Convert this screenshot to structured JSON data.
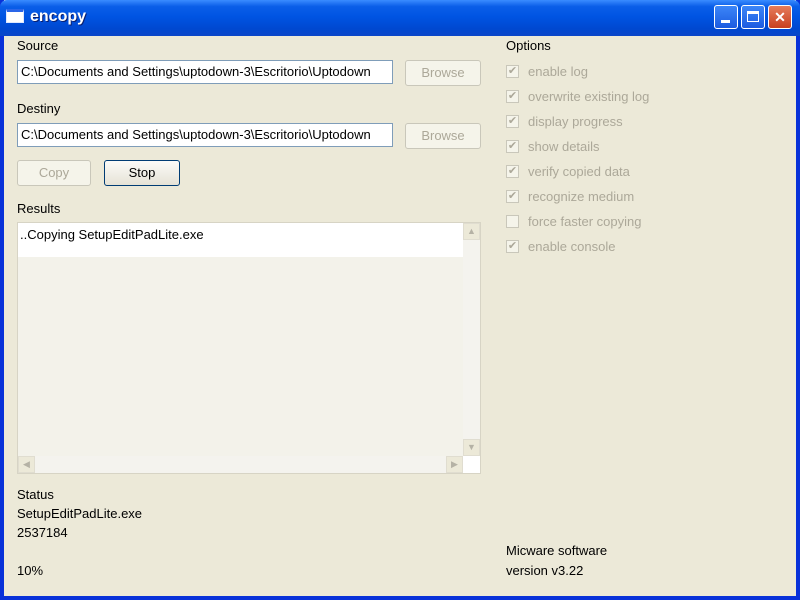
{
  "window": {
    "title": "encopy"
  },
  "titlebar": {
    "minimize": "minimize",
    "maximize": "maximize",
    "close": "✕"
  },
  "source": {
    "label": "Source",
    "value": "C:\\Documents and Settings\\uptodown-3\\Escritorio\\Uptodown",
    "browse": "Browse"
  },
  "destiny": {
    "label": "Destiny",
    "value": "C:\\Documents and Settings\\uptodown-3\\Escritorio\\Uptodown",
    "browse": "Browse"
  },
  "buttons": {
    "copy": "Copy",
    "stop": "Stop"
  },
  "results": {
    "label": "Results",
    "lines": [
      "..Copying SetupEditPadLite.exe"
    ]
  },
  "status": {
    "label": "Status",
    "file": "SetupEditPadLite.exe",
    "bytes": "2537184",
    "percent": "10%"
  },
  "options": {
    "label": "Options",
    "items": [
      {
        "label": "enable log",
        "checked": true
      },
      {
        "label": "overwrite existing log",
        "checked": true
      },
      {
        "label": "display progress",
        "checked": true
      },
      {
        "label": "show details",
        "checked": true
      },
      {
        "label": "verify copied data",
        "checked": true
      },
      {
        "label": "recognize medium",
        "checked": true
      },
      {
        "label": "force faster copying",
        "checked": false
      },
      {
        "label": "enable console",
        "checked": true
      }
    ]
  },
  "footer": {
    "company": "Micware software",
    "version": "version v3.22"
  },
  "icons": {
    "scroll_up": "arrow-up-icon",
    "scroll_down": "arrow-down-icon",
    "scroll_left": "arrow-left-icon",
    "scroll_right": "arrow-right-icon",
    "check": "checkmark-icon"
  }
}
